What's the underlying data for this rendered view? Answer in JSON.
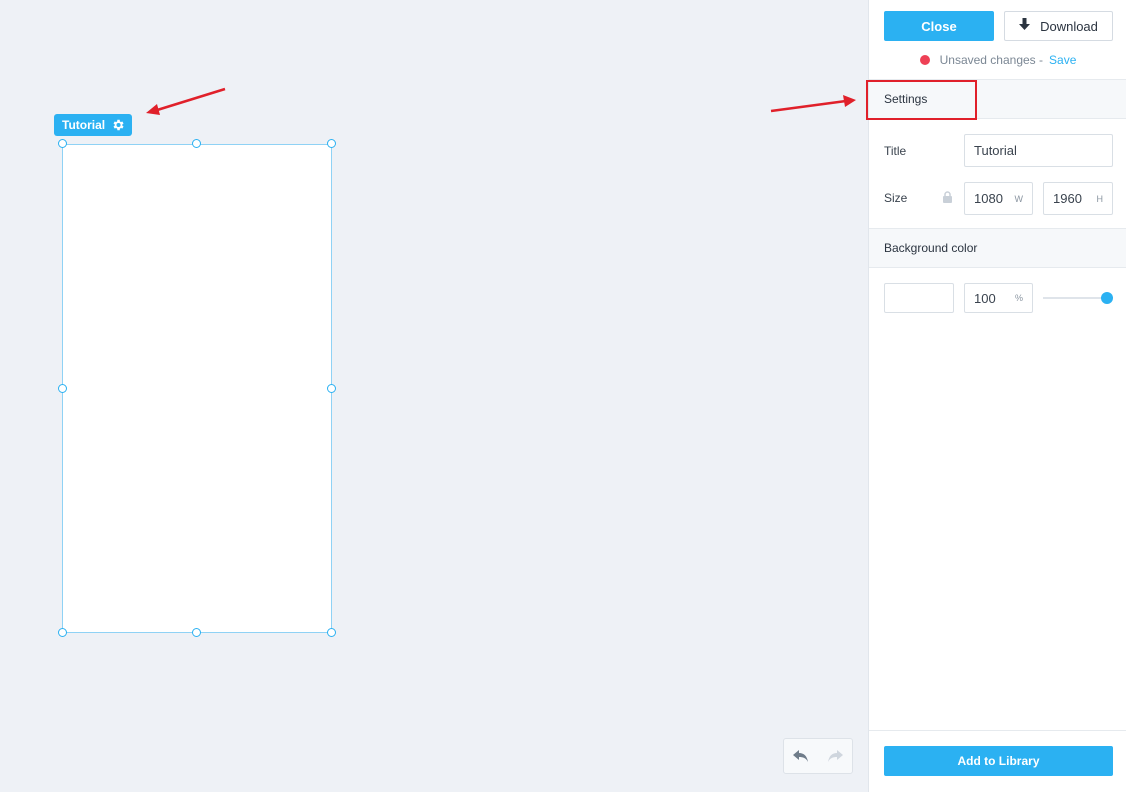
{
  "colors": {
    "accent": "#2bb1f2",
    "unsaved_dot": "#ee4055",
    "annotation_red": "#e0202a",
    "canvas_bg": "#eef1f6"
  },
  "artboard": {
    "name": "Tutorial",
    "settings_icon": "gear-icon"
  },
  "toolbar": {
    "close_label": "Close",
    "download_label": "Download",
    "download_icon": "download-arrow-icon"
  },
  "status": {
    "unsaved_text": "Unsaved changes -",
    "save_link": "Save"
  },
  "settings": {
    "header": "Settings",
    "title_label": "Title",
    "title_value": "Tutorial",
    "size_label": "Size",
    "lock_icon": "lock-icon",
    "width_value": "1080",
    "width_unit": "W",
    "height_value": "1960",
    "height_unit": "H"
  },
  "background": {
    "header": "Background color",
    "color_value": "#ffffff",
    "opacity_value": "100",
    "opacity_unit": "%",
    "opacity_fraction": 1.0
  },
  "history": {
    "undo_icon": "undo-icon",
    "redo_icon": "redo-icon"
  },
  "footer": {
    "add_library_label": "Add to Library"
  }
}
